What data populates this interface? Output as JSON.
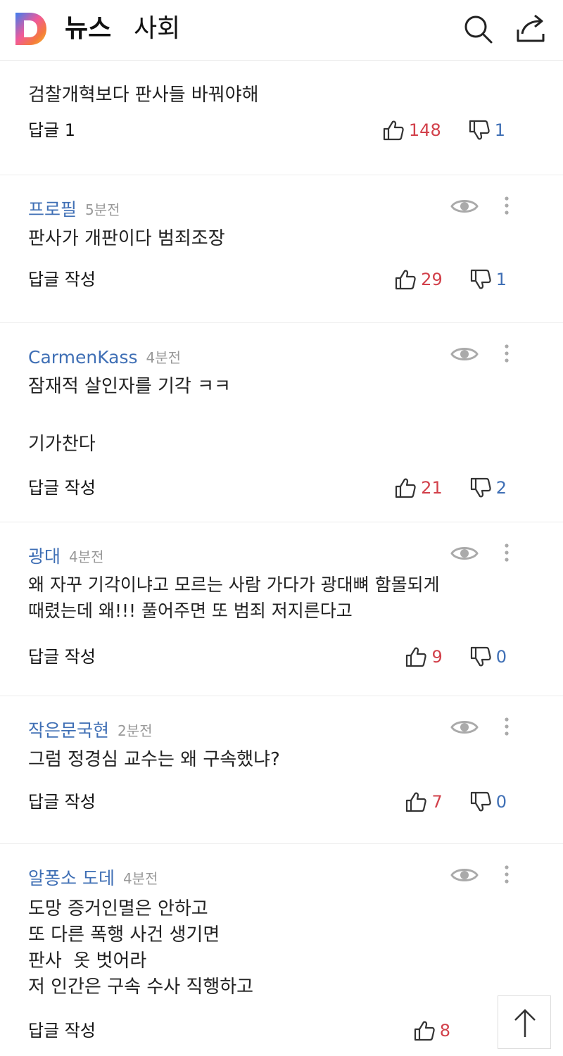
{
  "header": {
    "logo_letter": "D",
    "section": "뉴스",
    "category": "사회",
    "icons": [
      "search-icon",
      "share-icon"
    ]
  },
  "comments": [
    {
      "author": "",
      "time": "",
      "text": "검찰개혁보다 판사들 바꿔야해",
      "reply_label": "답글 1",
      "likes": "148",
      "dislikes": "1"
    },
    {
      "author": "프로필",
      "time": "5분전",
      "text": "판사가 개판이다 범죄조장",
      "reply_label": "답글 작성",
      "likes": "29",
      "dislikes": "1"
    },
    {
      "author": "CarmenKass",
      "time": "4분전",
      "text": "잠재적 살인자를 기각 ㅋㅋ\n\n기가찬다",
      "reply_label": "답글 작성",
      "likes": "21",
      "dislikes": "2"
    },
    {
      "author": "광대",
      "time": "4분전",
      "text": "왜 자꾸 기각이냐고 모르는 사람 가다가 광대뼈 함몰되게\n때렸는데 왜!!! 풀어주면 또 범죄 저지른다고",
      "reply_label": "답글 작성",
      "likes": "9",
      "dislikes": "0"
    },
    {
      "author": "작은문국현",
      "time": "2분전",
      "text": "그럼 정경심 교수는 왜 구속했냐?",
      "reply_label": "답글 작성",
      "likes": "7",
      "dislikes": "0"
    },
    {
      "author": "알퐁소 도데",
      "time": "4분전",
      "text": "도망 증거인멸은 안하고\n또 다른 폭행 사건 생기면\n판사  옷 벗어라\n저 인간은 구속 수사 직행하고",
      "reply_label": "답글 작성",
      "likes": "8",
      "dislikes": ""
    }
  ],
  "colors": {
    "author": "#3f6fb5",
    "like": "#d2404a",
    "dislike": "#3f6fb5"
  }
}
